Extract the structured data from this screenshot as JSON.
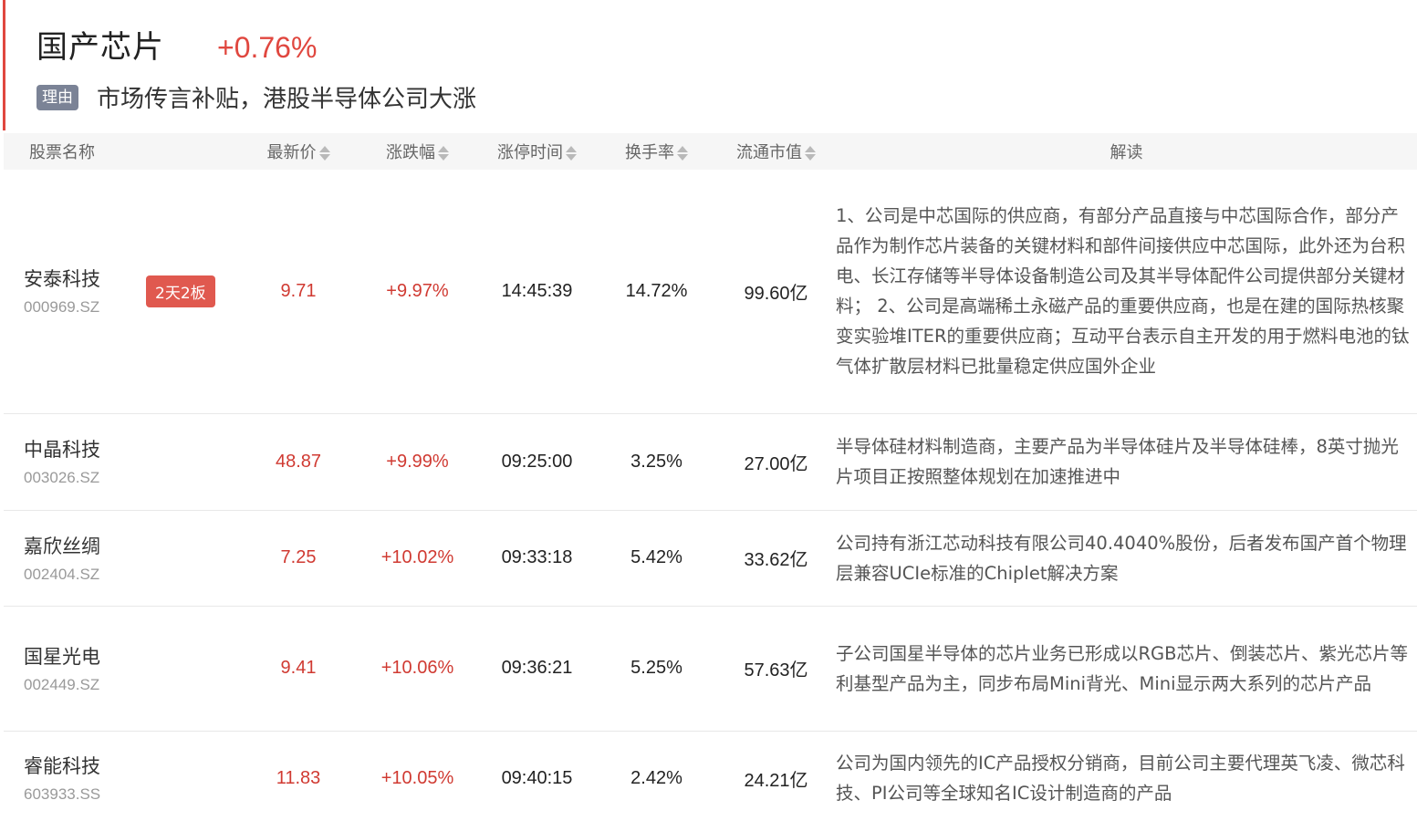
{
  "sector": {
    "title": "国产芯片",
    "change": "+0.76%",
    "reason_tag": "理由",
    "reason_text": "市场传言补贴，港股半导体公司大涨"
  },
  "colors": {
    "accent": "#e0473f",
    "tag_bg": "#7b8396",
    "badge_bg": "#e0594f",
    "up_red": "#d03a32"
  },
  "table": {
    "headers": {
      "name": "股票名称",
      "price": "最新价",
      "change": "涨跌幅",
      "limit_time": "涨停时间",
      "turnover": "换手率",
      "market_cap": "流通市值",
      "analysis": "解读"
    },
    "rows": [
      {
        "name": "安泰科技",
        "code": "000969.SZ",
        "badge": "2天2板",
        "price": "9.71",
        "change": "+9.97%",
        "limit_time": "14:45:39",
        "turnover": "14.72%",
        "market_cap": "99.60亿",
        "analysis": "1、公司是中芯国际的供应商，有部分产品直接与中芯国际合作，部分产品作为制作芯片装备的关键材料和部件间接供应中芯国际，此外还为台积电、长江存储等半导体设备制造公司及其半导体配件公司提供部分关键材料； 2、公司是高端稀土永磁产品的重要供应商，也是在建的国际热核聚变实验堆ITER的重要供应商；互动平台表示自主开发的用于燃料电池的钛气体扩散层材料已批量稳定供应国外企业"
      },
      {
        "name": "中晶科技",
        "code": "003026.SZ",
        "badge": "",
        "price": "48.87",
        "change": "+9.99%",
        "limit_time": "09:25:00",
        "turnover": "3.25%",
        "market_cap": "27.00亿",
        "analysis": "半导体硅材料制造商，主要产品为半导体硅片及半导体硅棒，8英寸抛光片项目正按照整体规划在加速推进中"
      },
      {
        "name": "嘉欣丝绸",
        "code": "002404.SZ",
        "badge": "",
        "price": "7.25",
        "change": "+10.02%",
        "limit_time": "09:33:18",
        "turnover": "5.42%",
        "market_cap": "33.62亿",
        "analysis": "公司持有浙江芯动科技有限公司40.4040%股份，后者发布国产首个物理层兼容UCIe标准的Chiplet解决方案"
      },
      {
        "name": "国星光电",
        "code": "002449.SZ",
        "badge": "",
        "price": "9.41",
        "change": "+10.06%",
        "limit_time": "09:36:21",
        "turnover": "5.25%",
        "market_cap": "57.63亿",
        "analysis": "子公司国星半导体的芯片业务已形成以RGB芯片、倒装芯片、紫光芯片等利基型产品为主，同步布局Mini背光、Mini显示两大系列的芯片产品"
      },
      {
        "name": "睿能科技",
        "code": "603933.SS",
        "badge": "",
        "price": "11.83",
        "change": "+10.05%",
        "limit_time": "09:40:15",
        "turnover": "2.42%",
        "market_cap": "24.21亿",
        "analysis": "公司为国内领先的IC产品授权分销商，目前公司主要代理英飞凌、微芯科技、PI公司等全球知名IC设计制造商的产品"
      }
    ]
  }
}
